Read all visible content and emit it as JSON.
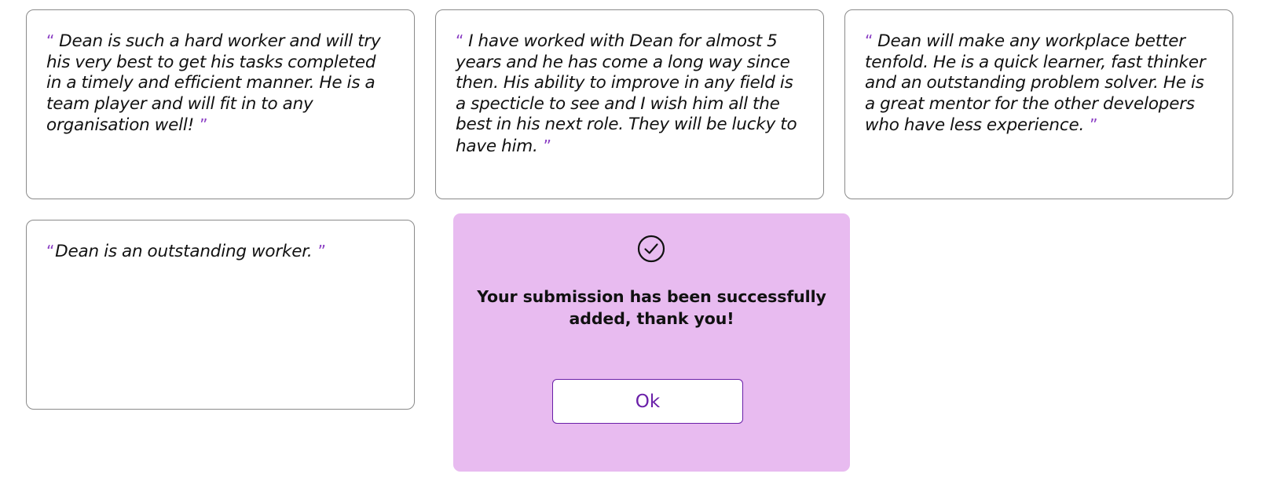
{
  "colors": {
    "accent": "#6a1fa8",
    "quote_mark": "#8b3fc4",
    "modal_background": "#e8bbf0",
    "card_border": "#8a8a8a"
  },
  "testimonials": [
    {
      "open_quote": "“",
      "text": "Dean is such a hard worker and will try his very best to get his tasks completed in a timely and efficient manner. He is a team player and will fit in to any organisation well!",
      "close_quote": "”"
    },
    {
      "open_quote": "“",
      "text": "I have worked with Dean for almost 5 years and he has come a long way since then. His ability to improve in any field is a specticle to see and I wish him all the best in his next role. They will be lucky to have him.",
      "close_quote": "”"
    },
    {
      "open_quote": "“",
      "text": "Dean will make any workplace better tenfold. He is a quick learner, fast thinker and an outstanding problem solver. He is a great mentor for the other developers who have less experience.",
      "close_quote": "”"
    },
    {
      "open_quote": "“",
      "text": "Dean is an outstanding worker.",
      "close_quote": "”"
    }
  ],
  "modal": {
    "icon": "check-circle-icon",
    "message": "Your submission has been successfully added, thank you!",
    "ok_label": "Ok"
  }
}
